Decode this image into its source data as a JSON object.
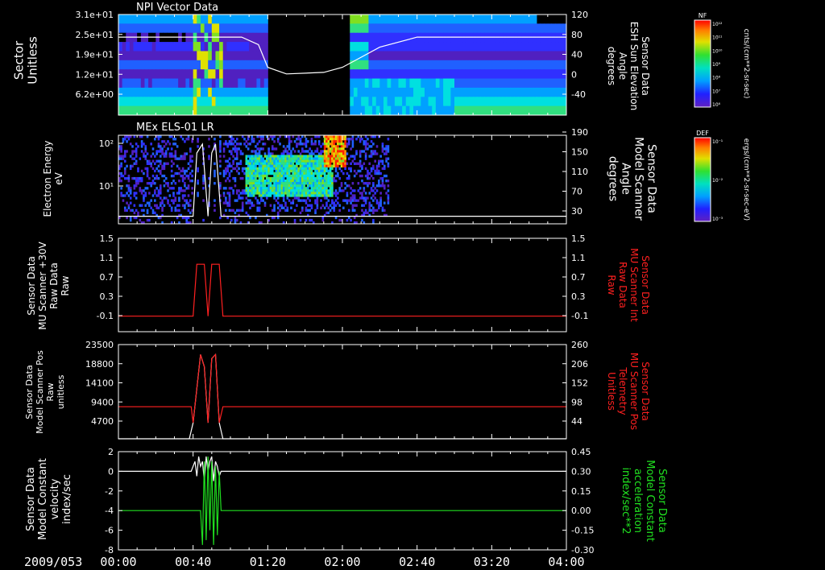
{
  "date_label": "2009/053",
  "x_ticks": [
    "00:00",
    "00:40",
    "01:20",
    "02:00",
    "02:40",
    "03:20",
    "04:00"
  ],
  "colors": {
    "background": "#000000",
    "axes": "#ffffff",
    "red_trace": "#ff2020",
    "green_trace": "#20e020"
  },
  "chart_data": [
    {
      "type": "heatmap",
      "title": "NPI Vector Data",
      "ylabel": "Sector\nUnitless",
      "y_ticks": [
        "3.1e+01",
        "2.5e+01",
        "1.9e+01",
        "1.2e+01",
        "6.2e+00"
      ],
      "y2label": "Sensor Data\nESH Sun Elevation\nAngle\ndegrees",
      "y2_ticks": [
        120,
        80,
        40,
        0,
        -40
      ],
      "y2lim": [
        -80,
        120
      ],
      "colorbar": {
        "label": "NF",
        "unit": "cnts/(cm**2-sr-sec)",
        "ticks": [
          "10¹²",
          "10¹¹",
          "10¹⁰",
          "10⁹",
          "10⁸",
          "10⁷",
          "10⁶"
        ]
      },
      "overlay_line": {
        "name": "ESH Sun Elevation Angle",
        "x_minutes": [
          0,
          40,
          50,
          66,
          75,
          80,
          90,
          110,
          120,
          130,
          140,
          160,
          200,
          240
        ],
        "y": [
          75,
          75,
          75,
          75,
          60,
          15,
          2,
          5,
          15,
          35,
          55,
          75,
          75,
          75
        ]
      },
      "data_gap_minutes": [
        80,
        124
      ]
    },
    {
      "type": "heatmap",
      "title": "MEx ELS-01 LR",
      "ylabel": "Electron Energy\neV",
      "y_ticks": [
        "10²",
        "10¹"
      ],
      "y2label": "Sensor Data\nModel Scanner\nAngle\ndegrees",
      "y2_ticks": [
        190,
        150,
        110,
        70,
        30
      ],
      "y2lim": [
        -10,
        190
      ],
      "colorbar": {
        "label": "DEF",
        "unit": "ergs/(cm**2-sr-sec-eV)",
        "ticks": [
          "10⁻¹",
          "10⁻²",
          "10⁻³"
        ]
      },
      "overlay_line": {
        "name": "Model Scanner Angle",
        "x_minutes": [
          0,
          40,
          42,
          45,
          48,
          50,
          52,
          55,
          58,
          240
        ],
        "y": [
          7,
          7,
          150,
          170,
          7,
          150,
          170,
          7,
          7,
          7
        ]
      },
      "data_extent_minutes": [
        0,
        145
      ]
    },
    {
      "type": "line",
      "ylabel": "Sensor Data\nMU Scanner +30V\nRaw Data\nRaw",
      "y_ticks": [
        1.5,
        1.1,
        0.7,
        0.3,
        -0.1
      ],
      "ylim": [
        -0.3,
        1.5
      ],
      "y2label": "Sensor Data\nMU Scanner Int\nRaw Data\nRaw",
      "y2_ticks": [
        1.5,
        1.1,
        0.7,
        0.3,
        -0.1
      ],
      "series": [
        {
          "name": "Sensor Data MU Scanner Int Raw Data Raw",
          "color": "#ff2020",
          "x_minutes": [
            0,
            40,
            41,
            42,
            46,
            47,
            48,
            49,
            50,
            51,
            53,
            54,
            55,
            56,
            240
          ],
          "y": [
            0,
            0,
            0.5,
            1,
            1,
            0.5,
            0,
            0.5,
            1,
            1,
            1,
            1,
            0.5,
            0,
            0
          ]
        }
      ]
    },
    {
      "type": "line",
      "ylabel": "Sensor Data\nModel Scanner Pos\nRaw\nunitless",
      "y_ticks": [
        23500,
        18800,
        14100,
        9400,
        4700
      ],
      "ylim": [
        0,
        23500
      ],
      "y2label": "Sensor Data\nMU Scanner Pos\nTelemetry\nUnitless",
      "y2_ticks": [
        260,
        206,
        152,
        98,
        44
      ],
      "series": [
        {
          "name": "Model Scanner Pos",
          "color": "#ffffff",
          "x_minutes": [
            0,
            38,
            40,
            44,
            46,
            48,
            50,
            52,
            54,
            56,
            240
          ],
          "y": [
            0,
            0,
            4000,
            21000,
            18000,
            4000,
            20000,
            21000,
            4000,
            0,
            0
          ]
        },
        {
          "name": "MU Scanner Pos Telemetry",
          "color": "#ff2020",
          "x_minutes": [
            0,
            39,
            40,
            44,
            46,
            48,
            50,
            52,
            54,
            56,
            240
          ],
          "y": [
            8000,
            8000,
            4000,
            21000,
            18000,
            4000,
            20000,
            21000,
            4000,
            8000,
            8000
          ]
        }
      ]
    },
    {
      "type": "line",
      "ylabel": "Sensor Data\nModel Constant\nvelocity\nindex/sec",
      "y_ticks": [
        2,
        0,
        -2,
        -4,
        -6,
        -8
      ],
      "ylim": [
        -8,
        2
      ],
      "y2label": "Sensor Data\nModel Constant\nacceleration\nindex/sec**2",
      "y2_ticks": [
        "0.45",
        "0.30",
        "0.15",
        "0.00",
        "-0.15",
        "-0.30"
      ],
      "series": [
        {
          "name": "Model Constant velocity",
          "color": "#ffffff",
          "x_minutes": [
            0,
            39,
            41,
            42,
            43,
            44,
            45,
            46,
            47,
            48,
            49,
            50,
            51,
            52,
            53,
            54,
            55,
            240
          ],
          "y": [
            0,
            0,
            1,
            -0.5,
            1.5,
            0.5,
            1,
            -1,
            1.5,
            0,
            1,
            1.5,
            -1,
            1,
            0.5,
            -0.5,
            0,
            0
          ]
        },
        {
          "name": "Model Constant acceleration",
          "color": "#20e020",
          "x_minutes": [
            0,
            44,
            45,
            46,
            47,
            48,
            49,
            50,
            51,
            52,
            53,
            54,
            55,
            240
          ],
          "y": [
            -4,
            -4,
            -7.5,
            1,
            -7,
            1.5,
            -6,
            1,
            -7.5,
            0.5,
            -6.5,
            0,
            -4,
            -4
          ]
        }
      ]
    }
  ]
}
